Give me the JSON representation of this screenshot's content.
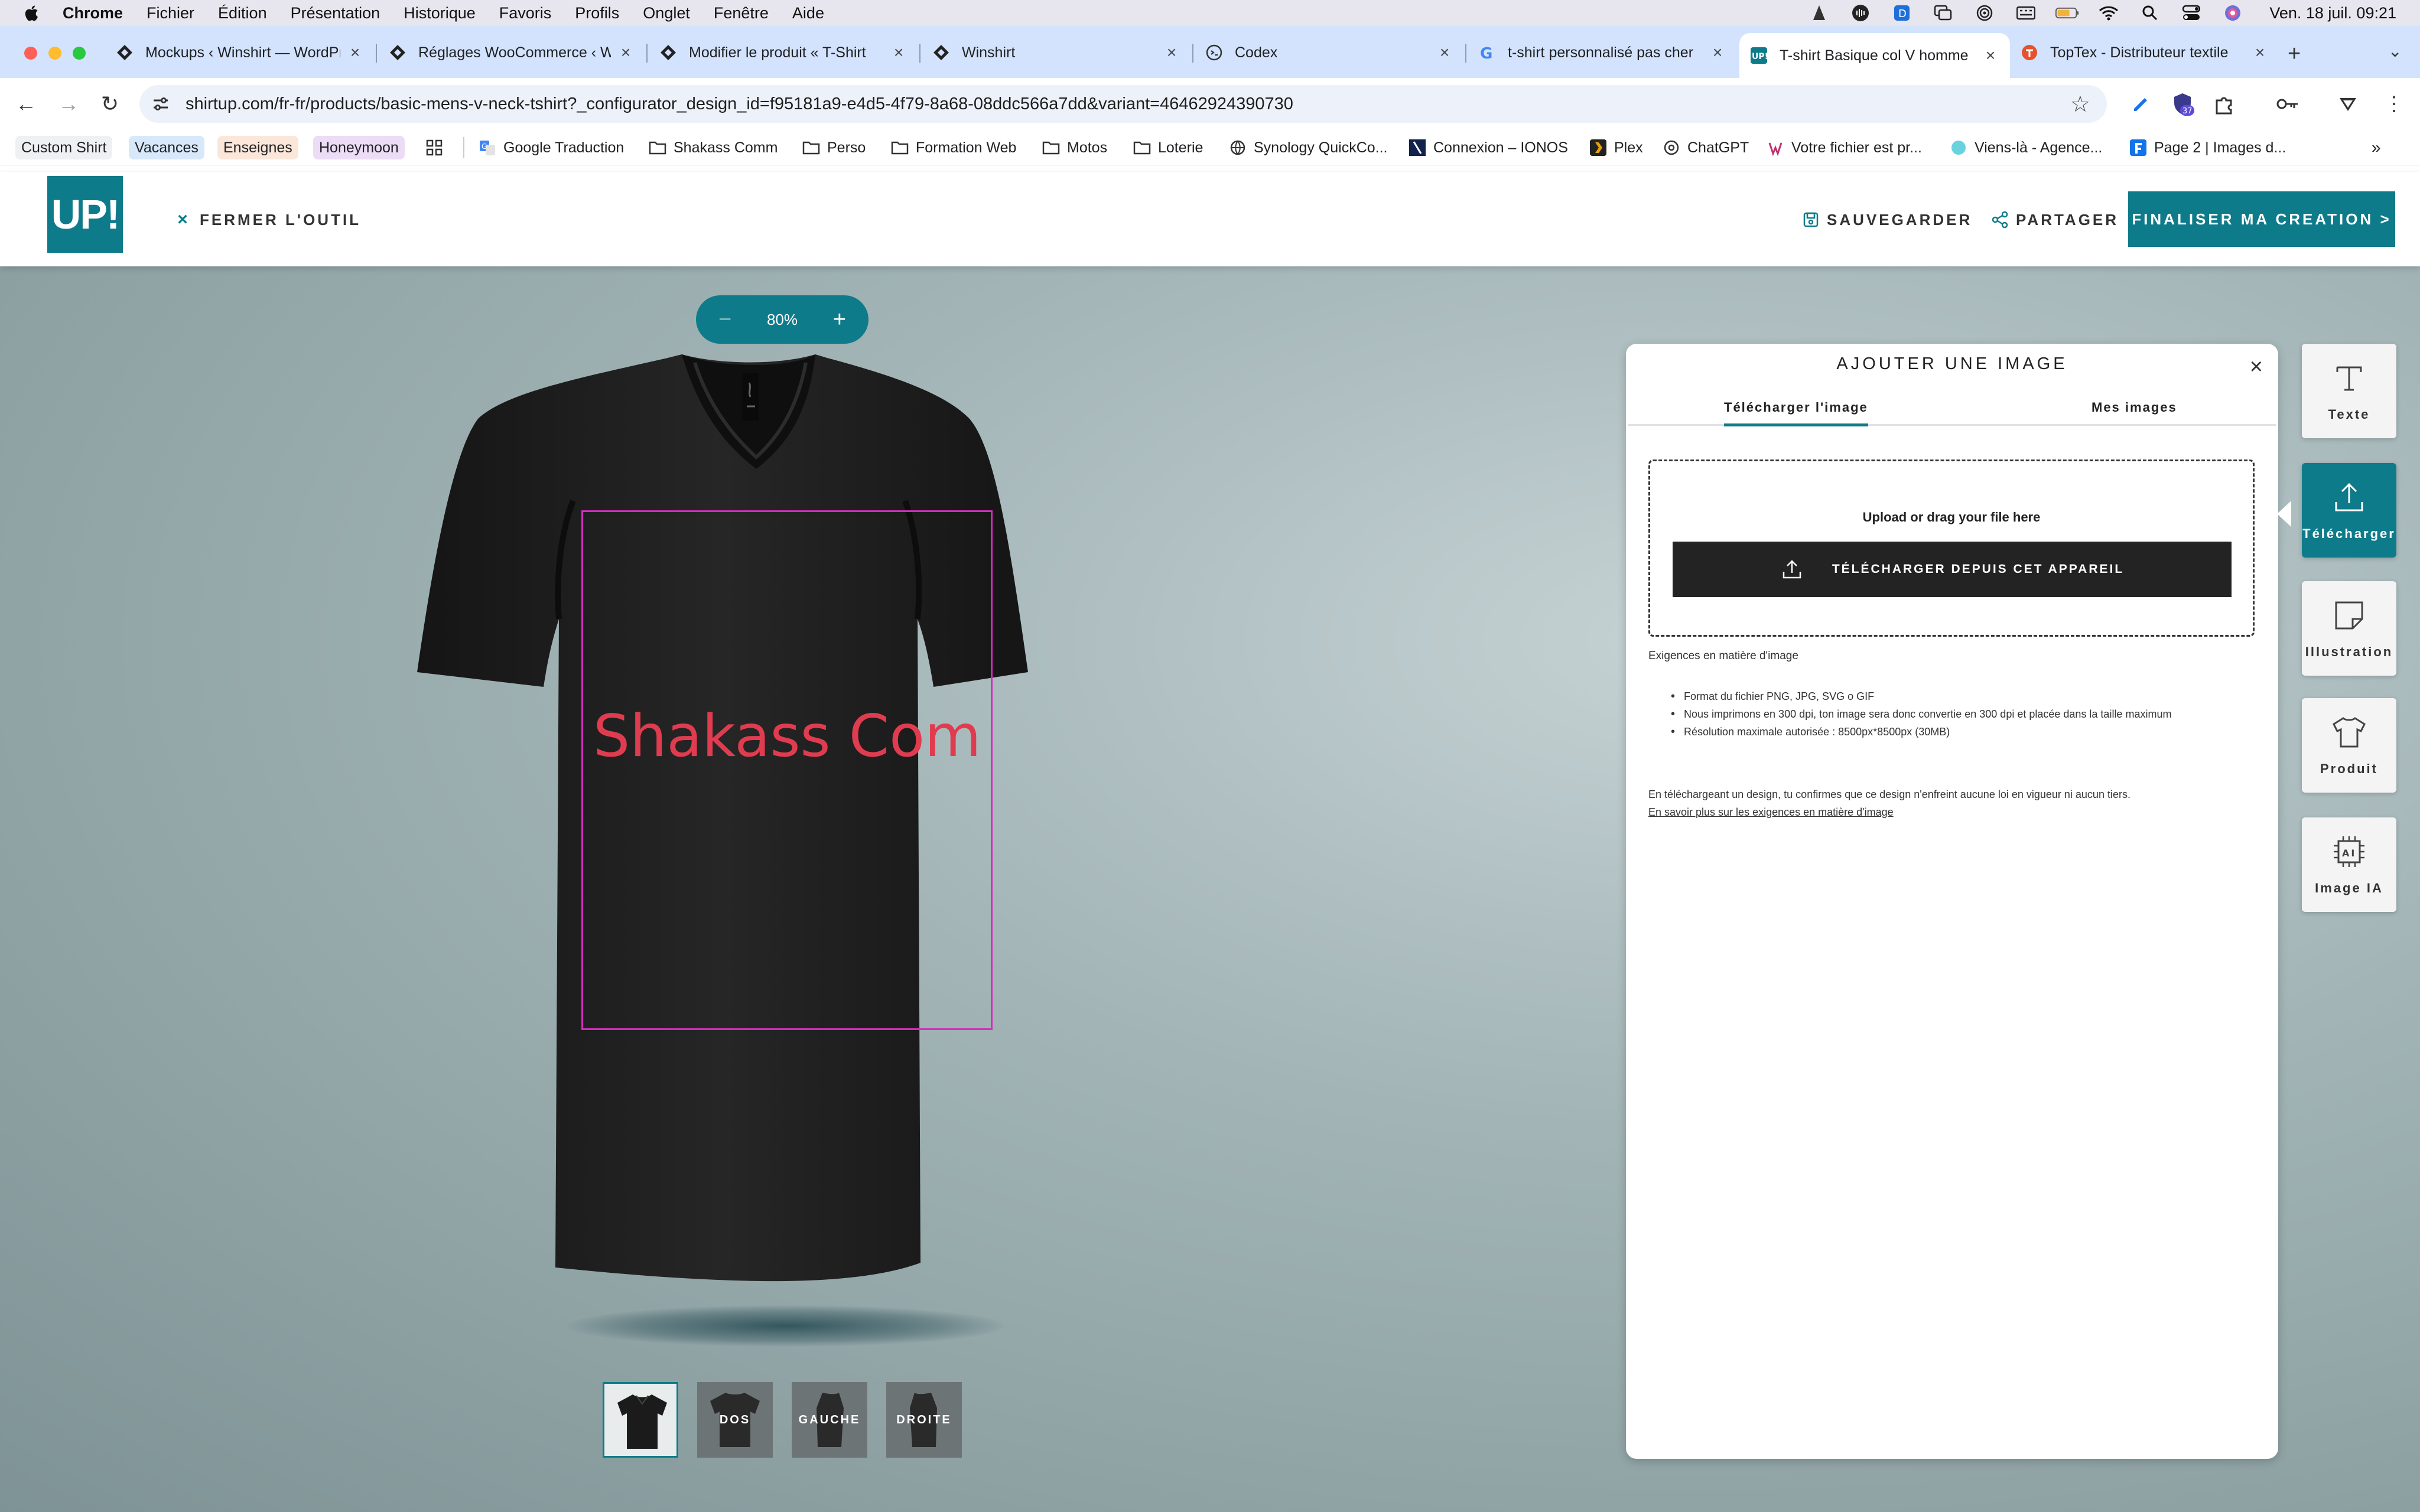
{
  "menubar": {
    "items": [
      "Chrome",
      "Fichier",
      "Édition",
      "Présentation",
      "Historique",
      "Favoris",
      "Profils",
      "Onglet",
      "Fenêtre",
      "Aide"
    ],
    "clock": "Ven. 18 juil.  09:21"
  },
  "tabs": [
    {
      "title": "Mockups ‹ Winshirt — WordPress",
      "icon": "winshirt-icon"
    },
    {
      "title": "Réglages WooCommerce ‹ Winshirt",
      "icon": "winshirt-icon"
    },
    {
      "title": "Modifier le produit « T-Shirt",
      "icon": "winshirt-icon"
    },
    {
      "title": "Winshirt",
      "icon": "winshirt-icon"
    },
    {
      "title": "Codex",
      "icon": "codex-icon"
    },
    {
      "title": "t-shirt personnalisé pas cher",
      "icon": "google-icon"
    },
    {
      "title": "T-shirt Basique col V homme",
      "icon": "shirtup-icon",
      "active": true
    },
    {
      "title": "TopTex - Distributeur textile",
      "icon": "toptex-icon"
    }
  ],
  "address": {
    "url": "shirtup.com/fr-fr/products/basic-mens-v-neck-tshirt?_configurator_design_id=f95181a9-e4d5-4f79-8a68-08ddc566a7dd&variant=46462924390730"
  },
  "extensions": {
    "badge_count": "37"
  },
  "bookmarks": [
    {
      "label": "Custom Shirt",
      "type": "chip"
    },
    {
      "label": "Vacances",
      "type": "chip"
    },
    {
      "label": "Enseignes",
      "type": "chip"
    },
    {
      "label": "Honeymoon",
      "type": "chip"
    },
    {
      "label": "Google Traduction",
      "type": "link"
    },
    {
      "label": "Shakass Comm",
      "type": "folder"
    },
    {
      "label": "Perso",
      "type": "folder"
    },
    {
      "label": "Formation Web",
      "type": "folder"
    },
    {
      "label": "Motos",
      "type": "folder"
    },
    {
      "label": "Loterie",
      "type": "folder"
    },
    {
      "label": "Synology QuickCo...",
      "type": "link"
    },
    {
      "label": "Connexion – IONOS",
      "type": "link"
    },
    {
      "label": "Plex",
      "type": "link"
    },
    {
      "label": "ChatGPT",
      "type": "link"
    },
    {
      "label": "Votre fichier est pr...",
      "type": "link"
    },
    {
      "label": "Viens-là - Agence...",
      "type": "link"
    },
    {
      "label": "Page 2 | Images d...",
      "type": "link"
    }
  ],
  "colors": {
    "accent": "#0e7b8a",
    "print_area": "#d62bbf",
    "design_text": "#e03c50",
    "shirt": "#1e1e1e"
  },
  "site": {
    "logo": "UP!",
    "close_tool": "FERMER L'OUTIL",
    "save": "SAUVEGARDER",
    "share": "PARTAGER",
    "finalize": "FINALISER MA CREATION >"
  },
  "canvas": {
    "zoom": "80%",
    "zoom_minus": "−",
    "zoom_plus": "+",
    "design_text": "Shakass Com",
    "views": [
      "",
      "DOS",
      "GAUCHE",
      "DROITE"
    ]
  },
  "panel": {
    "title": "AJOUTER UNE IMAGE",
    "tabs": [
      "Télécharger l'image",
      "Mes images"
    ],
    "drop_hint": "Upload or drag your file here",
    "upload_button": "TÉLÉCHARGER DEPUIS CET APPAREIL",
    "requirements_title": "Exigences en matière d'image",
    "requirements": [
      "Format du fichier PNG, JPG, SVG o GIF",
      "Nous imprimons en 300 dpi, ton image sera donc convertie en 300 dpi et placée dans la taille maximum",
      "Résolution maximale autorisée : 8500px*8500px (30MB)"
    ],
    "disclaimer": "En téléchargeant un design, tu confirmes que ce design n'enfreint aucune loi en vigueur ni aucun tiers.",
    "more_link": "En savoir plus sur les exigences en matière d'image"
  },
  "tools": [
    {
      "label": "Texte",
      "icon": "text-icon"
    },
    {
      "label": "Télécharger",
      "icon": "upload-icon"
    },
    {
      "label": "Illustration",
      "icon": "sticker-icon"
    },
    {
      "label": "Produit",
      "icon": "tshirt-icon"
    },
    {
      "label": "Image IA",
      "icon": "ai-icon"
    }
  ]
}
